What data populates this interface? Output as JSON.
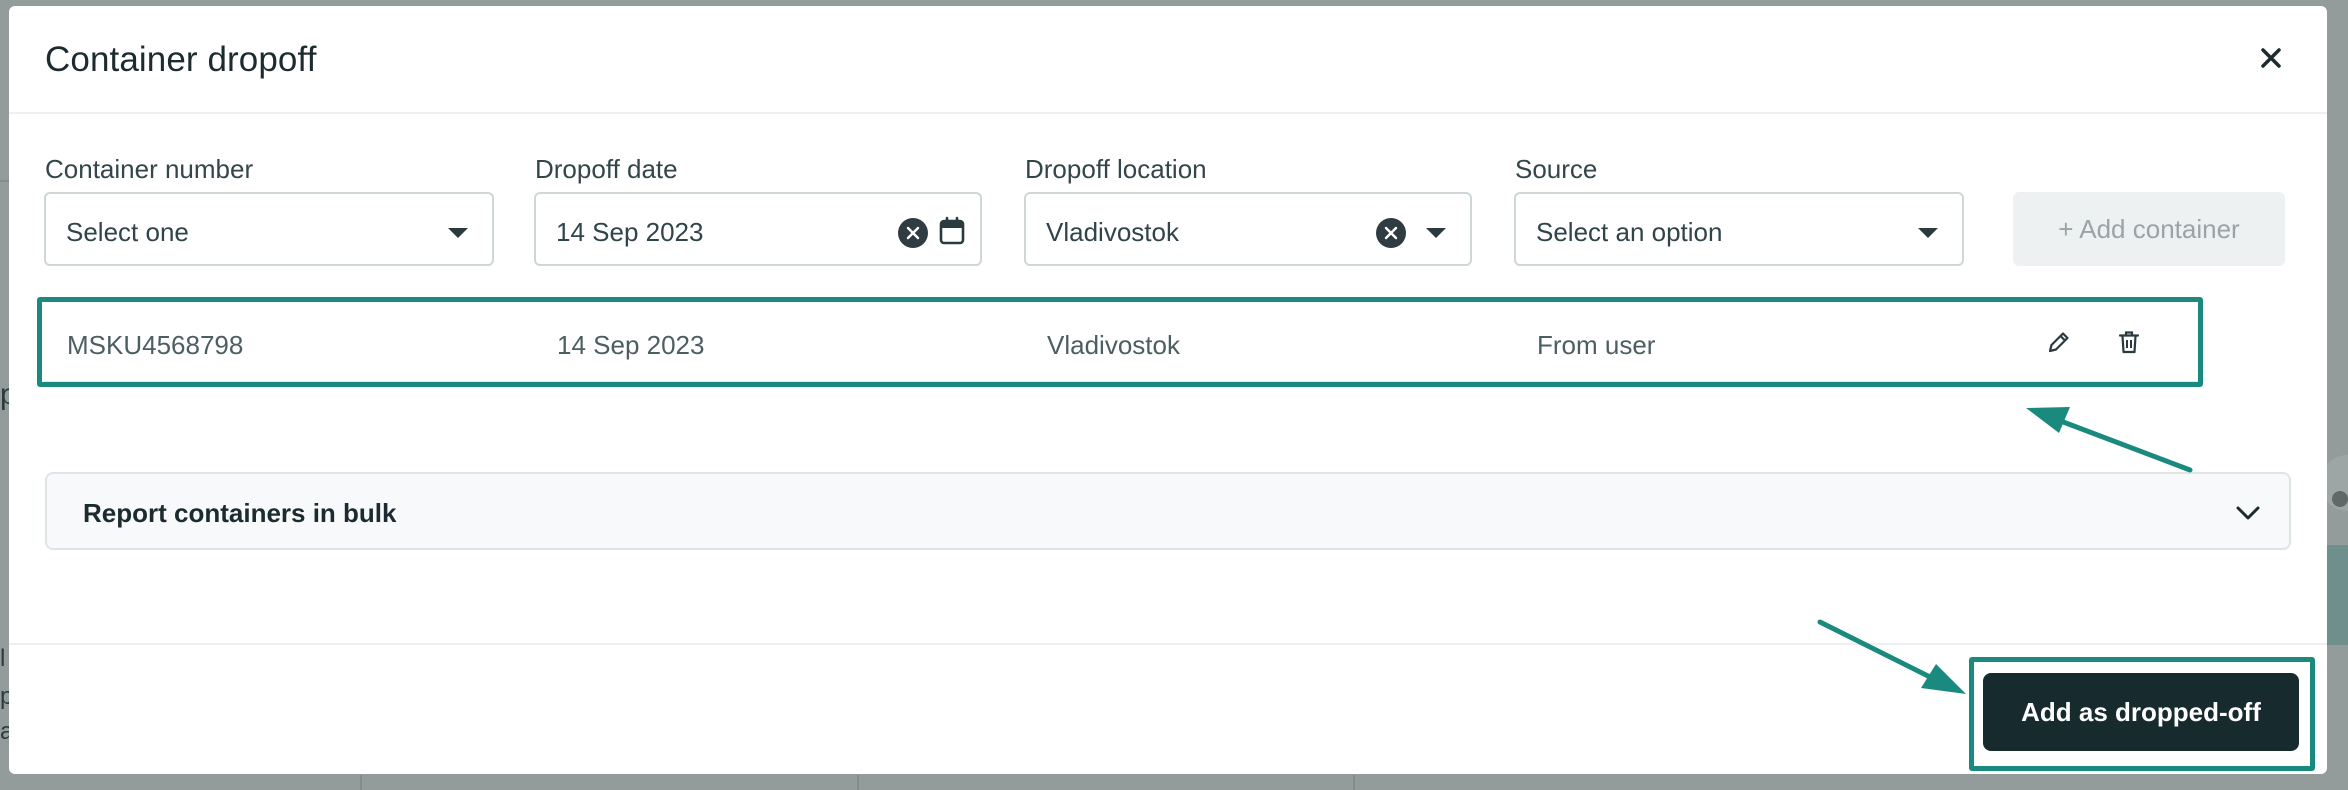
{
  "modal": {
    "title": "Container dropoff"
  },
  "form": {
    "container_number": {
      "label": "Container number",
      "value": "Select one"
    },
    "dropoff_date": {
      "label": "Dropoff date",
      "value": "14 Sep 2023"
    },
    "dropoff_location": {
      "label": "Dropoff location",
      "value": "Vladivostok"
    },
    "source": {
      "label": "Source",
      "value": "Select an option"
    },
    "add_container_label": "+ Add container"
  },
  "rows": [
    {
      "container": "MSKU4568798",
      "date": "14 Sep 2023",
      "location": "Vladivostok",
      "source": "From user"
    }
  ],
  "bulk": {
    "label": "Report containers in bulk"
  },
  "footer": {
    "submit_label": "Add as dropped-off"
  },
  "colors": {
    "accent": "#1b8a7e",
    "primary_button": "#172a2e",
    "backdrop": "#8e9796"
  },
  "icons": {
    "close": "close-icon",
    "clear": "clear-icon",
    "calendar": "calendar-icon",
    "caret": "caret-down-icon",
    "edit": "pencil-icon",
    "delete": "trash-icon",
    "expand": "chevron-down-icon"
  }
}
